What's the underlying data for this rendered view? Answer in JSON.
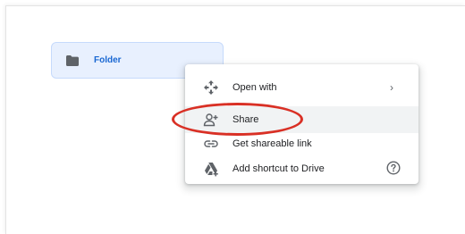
{
  "drive": {
    "folder": {
      "name": "Folder",
      "icon": "folder-icon"
    }
  },
  "context_menu": {
    "items": [
      {
        "label": "Open with",
        "icon": "open-with-icon",
        "trailing": "›"
      },
      {
        "label": "Share",
        "icon": "share-person-add-icon"
      },
      {
        "label": "Get shareable link",
        "icon": "link-icon"
      },
      {
        "label": "Add shortcut to Drive",
        "icon": "add-shortcut-drive-icon",
        "trailing": "help-icon"
      }
    ]
  },
  "colors": {
    "folder_tile_bg": "#e8f0fe",
    "folder_text": "#1967d2",
    "highlight_ring": "#d93025",
    "menu_hover_bg": "#f1f3f4"
  }
}
